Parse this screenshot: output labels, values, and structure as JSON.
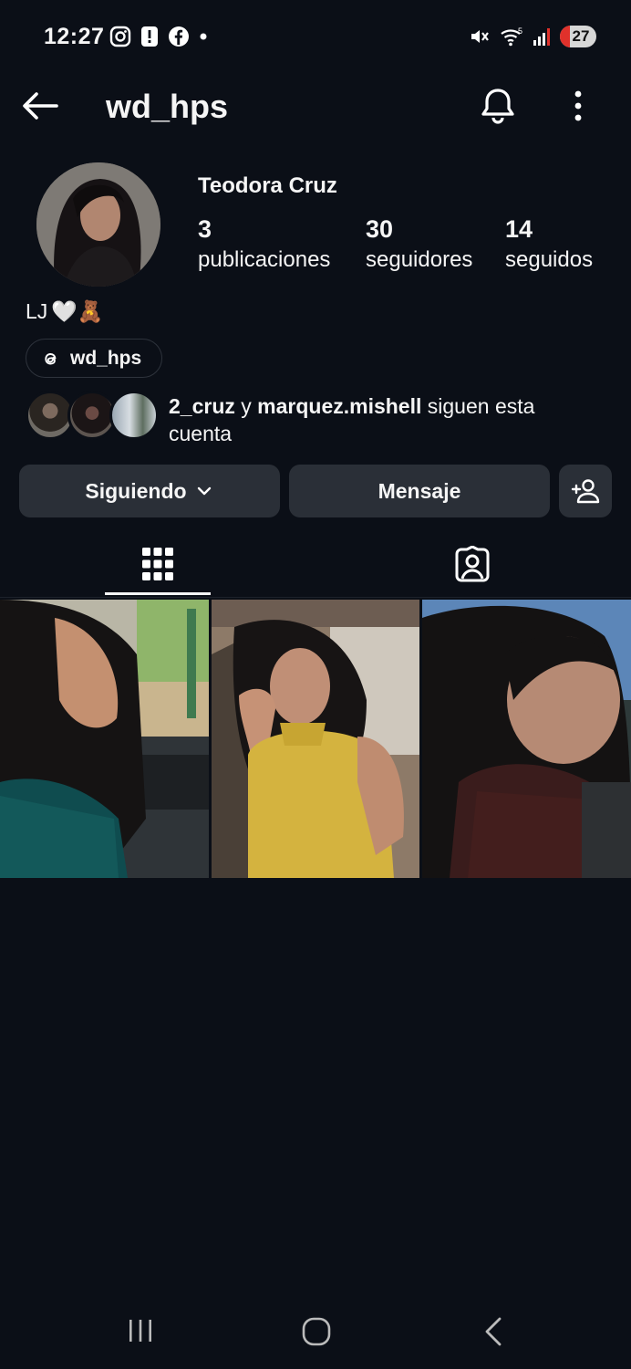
{
  "status_bar": {
    "time": "12:27",
    "battery": "27",
    "signal": "5"
  },
  "header": {
    "username": "wd_hps"
  },
  "profile": {
    "full_name": "Teodora Cruz",
    "stats": [
      {
        "value": "3",
        "label": "publicaciones"
      },
      {
        "value": "30",
        "label": "seguidores"
      },
      {
        "value": "14",
        "label": "seguidos"
      }
    ],
    "bio": "LJ",
    "bio_emoji": "🤍🧸",
    "threads_handle": "wd_hps",
    "mutuals": {
      "user1": "2_cruz",
      "connector": " y ",
      "user2": "marquez.mishell",
      "suffix": " siguen esta cuenta"
    }
  },
  "actions": {
    "following_label": "Siguiendo",
    "message_label": "Mensaje"
  },
  "colors": {
    "background": "#0b0f17",
    "button": "#2a2f37",
    "text": "#f5f5f5"
  },
  "icons": [
    "back-arrow-icon",
    "bell-icon",
    "more-vert-icon",
    "grid-icon",
    "tagged-icon",
    "add-person-icon",
    "threads-icon"
  ]
}
